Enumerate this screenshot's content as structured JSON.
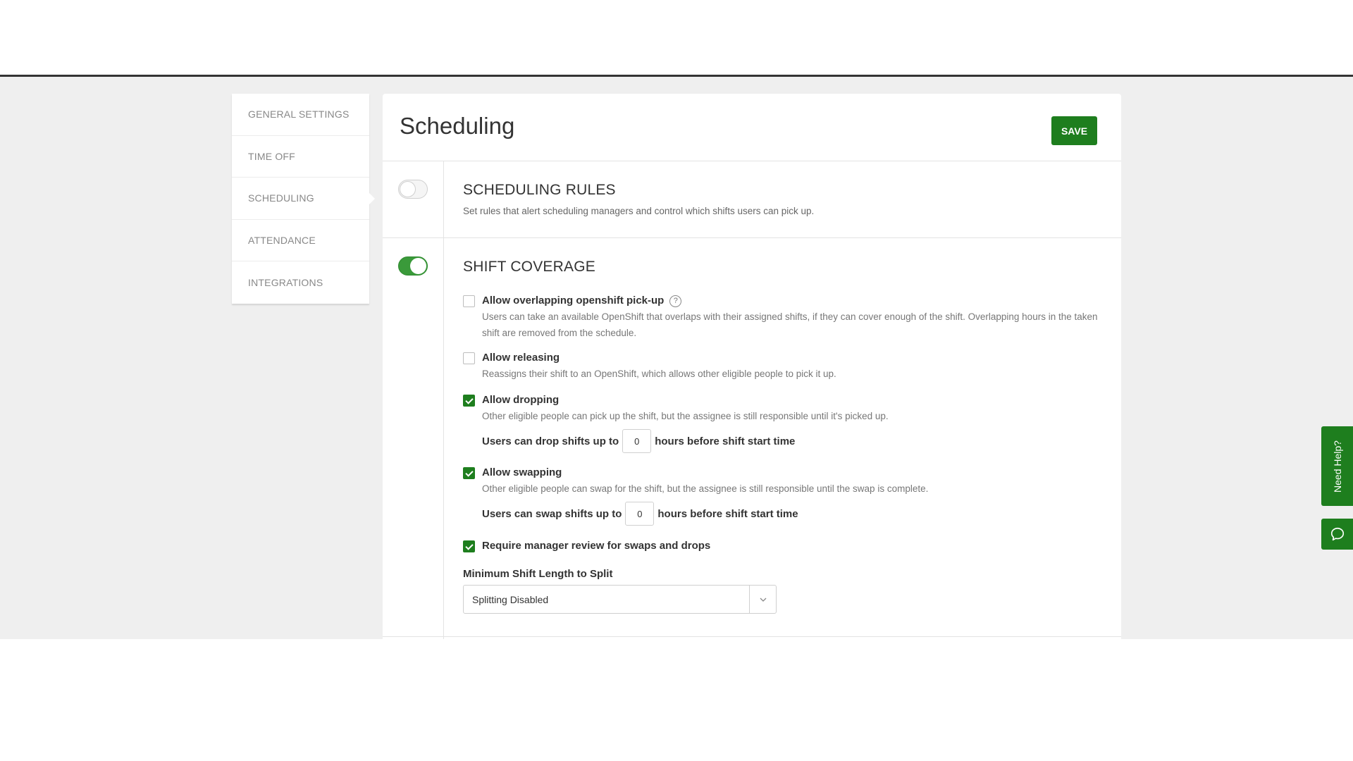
{
  "sidebar": {
    "items": [
      {
        "label": "GENERAL SETTINGS"
      },
      {
        "label": "TIME OFF"
      },
      {
        "label": "SCHEDULING"
      },
      {
        "label": "ATTENDANCE"
      },
      {
        "label": "INTEGRATIONS"
      }
    ],
    "active_index": 2
  },
  "header": {
    "title": "Scheduling",
    "save_label": "SAVE"
  },
  "scheduling_rules": {
    "title": "SCHEDULING RULES",
    "description": "Set rules that alert scheduling managers and control which shifts users can pick up.",
    "enabled": false
  },
  "shift_coverage": {
    "title": "SHIFT COVERAGE",
    "enabled": true,
    "options": {
      "overlap": {
        "label": "Allow overlapping openshift pick-up",
        "help_icon": "?",
        "description": "Users can take an available OpenShift that overlaps with their assigned shifts, if they can cover enough of the shift. Overlapping hours in the taken shift are removed from the schedule.",
        "checked": false
      },
      "releasing": {
        "label": "Allow releasing",
        "description": "Reassigns their shift to an OpenShift, which allows other eligible people to pick it up.",
        "checked": false
      },
      "dropping": {
        "label": "Allow dropping",
        "description": "Other eligible people can pick up the shift, but the assignee is still responsible until it's picked up.",
        "checked": true,
        "pre": "Users can drop shifts up to",
        "value": "0",
        "post": "hours before shift start time"
      },
      "swapping": {
        "label": "Allow swapping",
        "description": "Other eligible people can swap for the shift, but the assignee is still responsible until the swap is complete.",
        "checked": true,
        "pre": "Users can swap shifts up to",
        "value": "0",
        "post": "hours before shift start time"
      },
      "review": {
        "label": "Require manager review for swaps and drops",
        "checked": true
      }
    },
    "min_split": {
      "label": "Minimum Shift Length to Split",
      "selected": "Splitting Disabled"
    }
  },
  "help_widget": {
    "label": "Need Help?"
  },
  "colors": {
    "accent": "#1e7e1e",
    "toggle_on": "#3a9a3a"
  }
}
